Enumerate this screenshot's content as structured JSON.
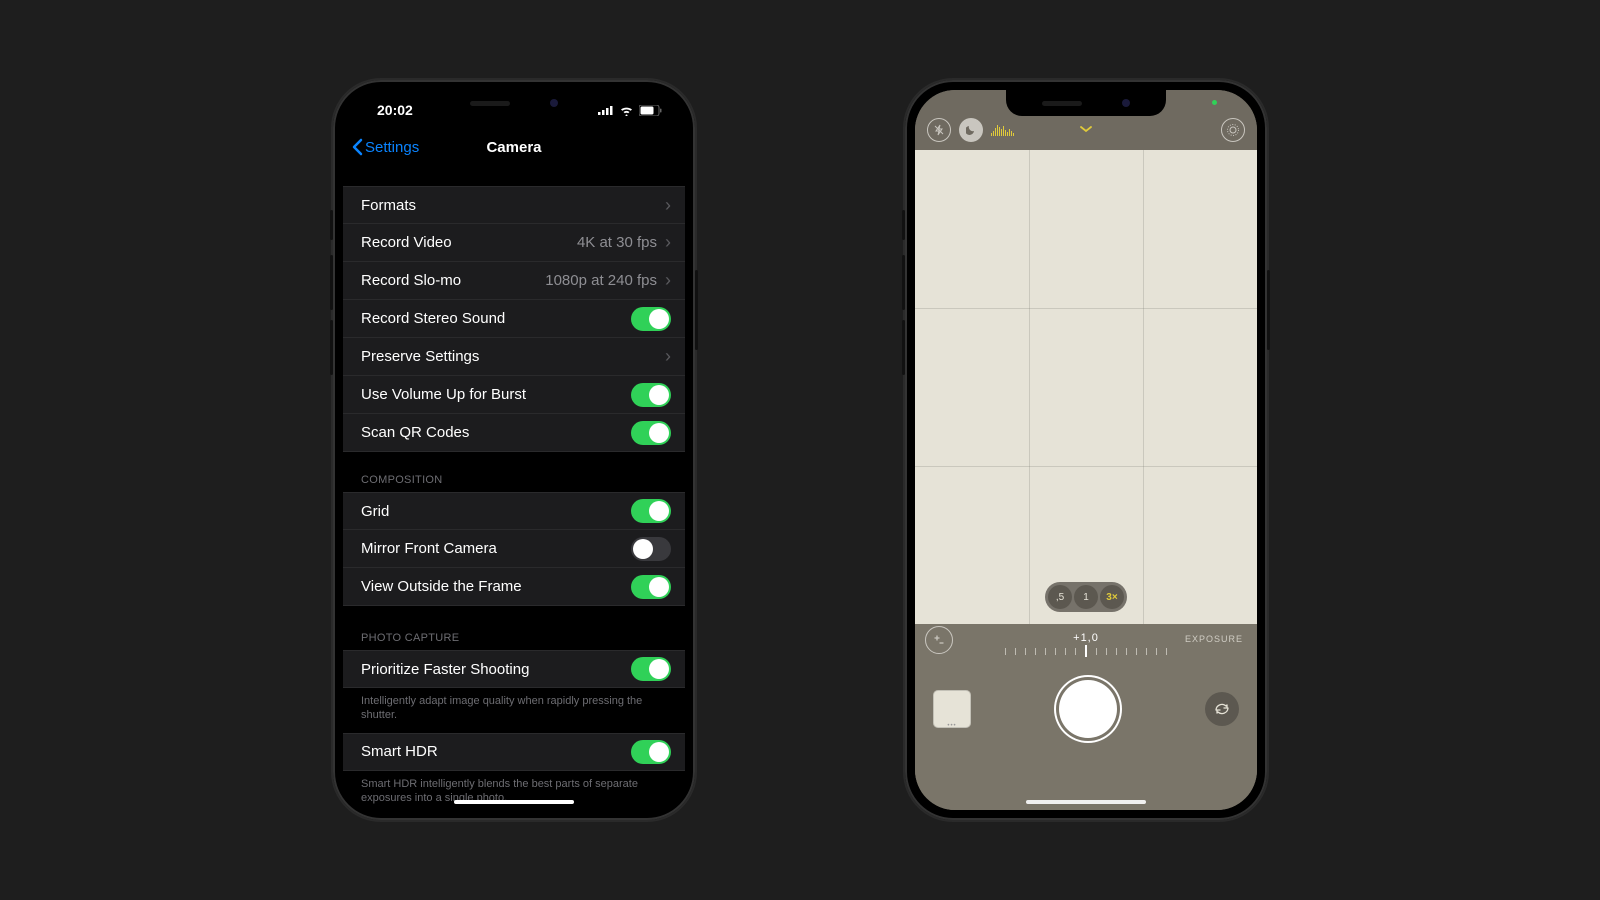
{
  "left": {
    "status": {
      "time": "20:02"
    },
    "nav": {
      "back": "Settings",
      "title": "Camera"
    },
    "group1": [
      {
        "label": "Formats",
        "type": "disclosure"
      },
      {
        "label": "Record Video",
        "value": "4K at 30 fps",
        "type": "disclosure"
      },
      {
        "label": "Record Slo-mo",
        "value": "1080p at 240 fps",
        "type": "disclosure"
      },
      {
        "label": "Record Stereo Sound",
        "type": "toggle",
        "on": true
      },
      {
        "label": "Preserve Settings",
        "type": "disclosure"
      },
      {
        "label": "Use Volume Up for Burst",
        "type": "toggle",
        "on": true
      },
      {
        "label": "Scan QR Codes",
        "type": "toggle",
        "on": true
      }
    ],
    "header2": "COMPOSITION",
    "group2": [
      {
        "label": "Grid",
        "type": "toggle",
        "on": true
      },
      {
        "label": "Mirror Front Camera",
        "type": "toggle",
        "on": false
      },
      {
        "label": "View Outside the Frame",
        "type": "toggle",
        "on": true
      }
    ],
    "header3": "PHOTO CAPTURE",
    "group3": [
      {
        "label": "Prioritize Faster Shooting",
        "type": "toggle",
        "on": true
      }
    ],
    "footer3": "Intelligently adapt image quality when rapidly pressing the shutter.",
    "group4": [
      {
        "label": "Smart HDR",
        "type": "toggle",
        "on": true
      }
    ],
    "footer4": "Smart HDR intelligently blends the best parts of separate exposures into a single photo."
  },
  "right": {
    "zoom": [
      {
        "label": ",5",
        "active": false
      },
      {
        "label": "1",
        "active": false
      },
      {
        "label": "3×",
        "active": true
      }
    ],
    "exposure": {
      "value": "+1,0",
      "label": "EXPOSURE"
    }
  }
}
